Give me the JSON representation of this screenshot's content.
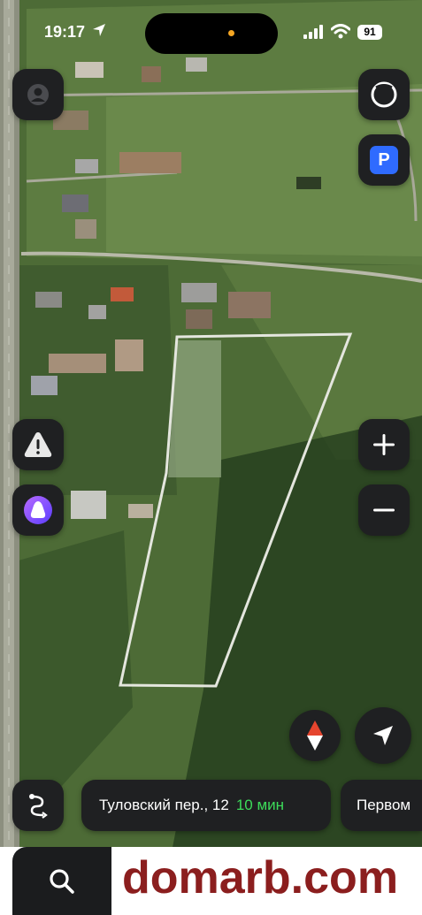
{
  "status_bar": {
    "time": "19:17",
    "battery": "91"
  },
  "top_controls": {
    "profile_icon": "person-icon",
    "layers_icon": "ring-icon",
    "parking_label": "P"
  },
  "side_controls": {
    "alert_label": "!",
    "zoom_in_label": "+",
    "zoom_out_label": "−"
  },
  "route_bar": {
    "address": "Туловский пер., 12",
    "duration": "10 мин",
    "next_chip": "Первом"
  },
  "watermark": "domarb.com",
  "colors": {
    "accent_green": "#3ddc5a",
    "parking_blue": "#2f6bff",
    "alice_purple": "#7b4dff",
    "watermark": "#8b1e1e"
  }
}
